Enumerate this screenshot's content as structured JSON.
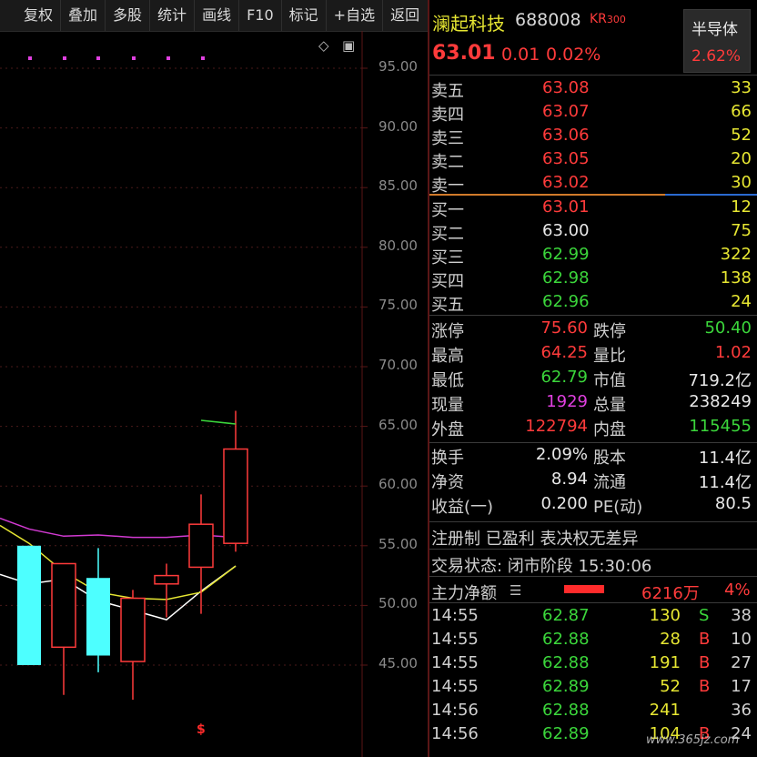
{
  "toolbar": {
    "items": [
      "复权",
      "叠加",
      "多股",
      "统计",
      "画线",
      "F10",
      "标记",
      "+自选",
      "返回"
    ]
  },
  "chart": {
    "price_labels": [
      "95.00",
      "90.00",
      "85.00",
      "80.00",
      "75.00",
      "70.00",
      "65.00",
      "60.00",
      "55.00",
      "50.00",
      "45.00"
    ],
    "candles": [
      {
        "open": 55,
        "close": 45,
        "high": 55,
        "low": 45,
        "color": "cyan"
      },
      {
        "open": 46.5,
        "close": 53.5,
        "high": 53.5,
        "low": 42.5,
        "color": "red"
      },
      {
        "open": 52.3,
        "close": 45.8,
        "high": 54.8,
        "low": 44.4,
        "color": "cyan"
      },
      {
        "open": 45.3,
        "close": 50.6,
        "high": 51.3,
        "low": 42.1,
        "color": "red"
      },
      {
        "open": 51.8,
        "close": 52.5,
        "high": 53.5,
        "low": 49.0,
        "color": "red"
      },
      {
        "open": 53.2,
        "close": 56.8,
        "high": 59.3,
        "low": 49.3,
        "color": "red"
      },
      {
        "open": 55.2,
        "close": 63.1,
        "high": 66.3,
        "low": 54.5,
        "color": "red"
      }
    ],
    "markers": [
      "$"
    ],
    "colors": {
      "up": "#ff3b3b",
      "down": "#4dffff",
      "ma1": "#ffffff",
      "ma2": "#e6e632",
      "ma3": "#d23ad2"
    }
  },
  "stock": {
    "name": "澜起科技",
    "code": "688008",
    "tag": "KR",
    "tag_num": "300",
    "price": "63.01",
    "change": "0.01",
    "change_pct": "0.02%",
    "sector": "半导体",
    "sector_pct": "2.62%"
  },
  "order_book": {
    "sell": [
      {
        "label": "卖五",
        "price": "63.08",
        "vol": "33"
      },
      {
        "label": "卖四",
        "price": "63.07",
        "vol": "66"
      },
      {
        "label": "卖三",
        "price": "63.06",
        "vol": "52"
      },
      {
        "label": "卖二",
        "price": "63.05",
        "vol": "20"
      },
      {
        "label": "卖一",
        "price": "63.02",
        "vol": "30"
      }
    ],
    "buy": [
      {
        "label": "买一",
        "price": "63.01",
        "vol": "12"
      },
      {
        "label": "买二",
        "price": "63.00",
        "vol": "75"
      },
      {
        "label": "买三",
        "price": "62.99",
        "vol": "322"
      },
      {
        "label": "买四",
        "price": "62.98",
        "vol": "138"
      },
      {
        "label": "买五",
        "price": "62.96",
        "vol": "24"
      }
    ]
  },
  "stats": {
    "limit_up_label": "涨停",
    "limit_up": "75.60",
    "limit_down_label": "跌停",
    "limit_down": "50.40",
    "high_label": "最高",
    "high": "64.25",
    "vol_ratio_label": "量比",
    "vol_ratio": "1.02",
    "low_label": "最低",
    "low": "62.79",
    "mktcap_label": "市值",
    "mktcap": "719.2亿",
    "curvol_label": "现量",
    "curvol": "1929",
    "totvol_label": "总量",
    "totvol": "238249",
    "outer_label": "外盘",
    "outer": "122794",
    "inner_label": "内盘",
    "inner": "115455",
    "turnover_label": "换手",
    "turnover": "2.09%",
    "capital_label": "股本",
    "capital": "11.4亿",
    "nav_label": "净资",
    "nav": "8.94",
    "float_label": "流通",
    "float": "11.4亿",
    "eps_label": "收益(一)",
    "eps": "0.200",
    "pe_label": "PE(动)",
    "pe": "80.5"
  },
  "info": {
    "registration": "注册制 已盈利 表决权无差异",
    "trade_status": "交易状态: 闭市阶段 15:30:06",
    "main_flow_label": "主力净额",
    "main_flow_value": "6216万",
    "main_flow_pct": "4%"
  },
  "ticks": [
    {
      "time": "14:55",
      "price": "62.87",
      "vol": "130",
      "side": "S",
      "count": "38"
    },
    {
      "time": "14:55",
      "price": "62.88",
      "vol": "28",
      "side": "B",
      "count": "10"
    },
    {
      "time": "14:55",
      "price": "62.88",
      "vol": "191",
      "side": "B",
      "count": "27"
    },
    {
      "time": "14:55",
      "price": "62.89",
      "vol": "52",
      "side": "B",
      "count": "17"
    },
    {
      "time": "14:56",
      "price": "62.88",
      "vol": "241",
      "side": "",
      "count": "36"
    },
    {
      "time": "14:56",
      "price": "62.89",
      "vol": "104",
      "side": "B",
      "count": "24"
    }
  ],
  "watermark": "www.365jz.com"
}
